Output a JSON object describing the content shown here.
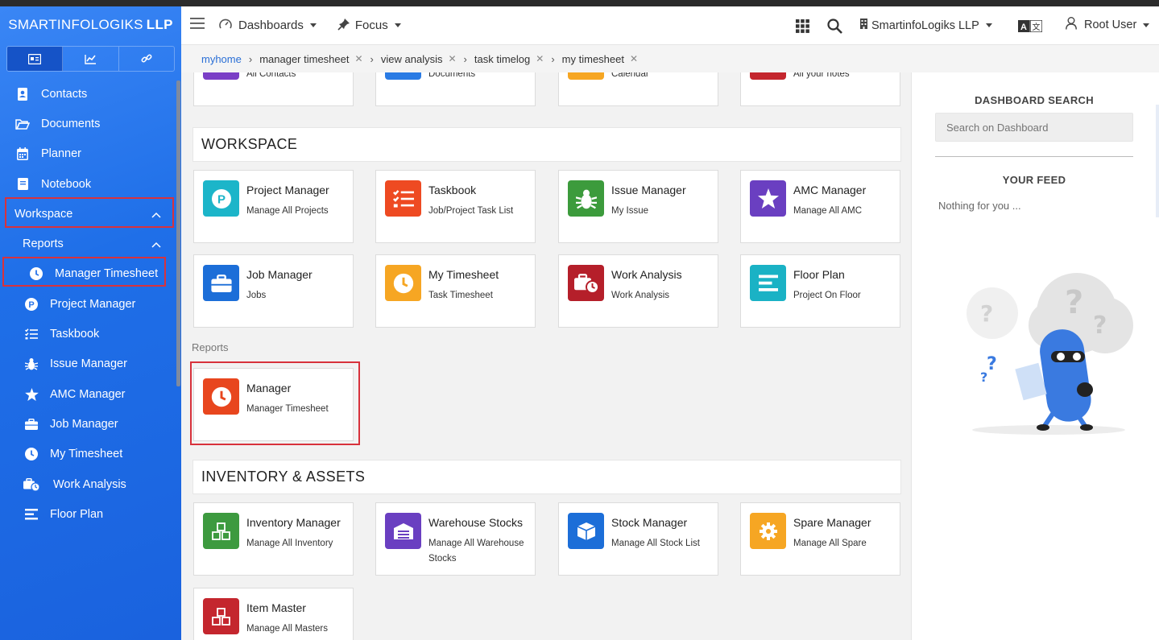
{
  "brand": {
    "name_light": "SMARTINFOLOGIKS",
    "name_bold": "LLP"
  },
  "sidebar": {
    "tabs": [
      {
        "icon": "id-card-icon",
        "active": true
      },
      {
        "icon": "chart-line-icon",
        "active": false
      },
      {
        "icon": "link-icon",
        "active": false
      }
    ],
    "items": [
      {
        "label": "Contacts",
        "icon": "contact-book-icon"
      },
      {
        "label": "Documents",
        "icon": "folder-open-icon"
      },
      {
        "label": "Planner",
        "icon": "calendar-icon"
      },
      {
        "label": "Notebook",
        "icon": "notebook-icon"
      },
      {
        "label": "Workspace",
        "icon": "chevron-up-icon"
      },
      {
        "label": "Reports",
        "icon": "chevron-up-icon"
      },
      {
        "label": "Manager Timesheet",
        "icon": "clock-icon"
      },
      {
        "label": "Project Manager",
        "icon": "p-circle-icon"
      },
      {
        "label": "Taskbook",
        "icon": "task-list-icon"
      },
      {
        "label": "Issue Manager",
        "icon": "bug-icon"
      },
      {
        "label": "AMC Manager",
        "icon": "star-icon"
      },
      {
        "label": "Job Manager",
        "icon": "briefcase-icon"
      },
      {
        "label": "My Timesheet",
        "icon": "clock-icon"
      },
      {
        "label": "Work Analysis",
        "icon": "briefcase-clock-icon"
      },
      {
        "label": "Floor Plan",
        "icon": "align-lines-icon"
      }
    ]
  },
  "topbar": {
    "dashboards": "Dashboards",
    "focus": "Focus",
    "company": "SmartinfoLogiks LLP",
    "user": "Root User"
  },
  "breadcrumb": [
    "myhome",
    "manager timesheet",
    "view analysis",
    "task timelog",
    "my timesheet"
  ],
  "main": {
    "top_cards": [
      {
        "sub": "All Contacts",
        "color": "#7a3fc6"
      },
      {
        "sub": "Documents",
        "color": "#2a7be4"
      },
      {
        "sub": "Calendar",
        "color": "#f6a623"
      },
      {
        "sub": "All your notes",
        "color": "#c4262e"
      }
    ],
    "workspace_title": "WORKSPACE",
    "workspace_cards": [
      {
        "title": "Project Manager",
        "sub": "Manage All Projects",
        "color": "#1cb5c9",
        "icon": "p-circle-icon"
      },
      {
        "title": "Taskbook",
        "sub": "Job/Project Task List",
        "color": "#ee4a22",
        "icon": "task-list-icon"
      },
      {
        "title": "Issue Manager",
        "sub": "My Issue",
        "color": "#3c9b3c",
        "icon": "bug-icon"
      },
      {
        "title": "AMC Manager",
        "sub": "Manage All AMC",
        "color": "#6a3fc1",
        "icon": "star-icon"
      },
      {
        "title": "Job Manager",
        "sub": "Jobs",
        "color": "#1c6ed8",
        "icon": "briefcase-icon"
      },
      {
        "title": "My Timesheet",
        "sub": "Task Timesheet",
        "color": "#f6a623",
        "icon": "clock-icon"
      },
      {
        "title": "Work Analysis",
        "sub": "Work Analysis",
        "color": "#b51f2a",
        "icon": "briefcase-clock-icon"
      },
      {
        "title": "Floor Plan",
        "sub": "Project On Floor",
        "color": "#1ab2c5",
        "icon": "align-lines-icon"
      }
    ],
    "reports_label": "Reports",
    "reports_cards": [
      {
        "title": "Manager",
        "sub": "Manager Timesheet",
        "color": "#e8461e",
        "icon": "clock-icon"
      }
    ],
    "inventory_title": "INVENTORY & ASSETS",
    "inventory_cards": [
      {
        "title": "Inventory Manager",
        "sub": "Manage All Inventory",
        "color": "#3d9a3f",
        "icon": "cubes-icon"
      },
      {
        "title": "Warehouse Stocks",
        "sub": "Manage All Warehouse Stocks",
        "color": "#6a3fc1",
        "icon": "warehouse-icon"
      },
      {
        "title": "Stock Manager",
        "sub": "Manage All Stock List",
        "color": "#1c6ed8",
        "icon": "box-icon"
      },
      {
        "title": "Spare Manager",
        "sub": "Manage All Spare",
        "color": "#f6a623",
        "icon": "gear-icon"
      },
      {
        "title": "Item Master",
        "sub": "Manage All Masters",
        "color": "#c4262e",
        "icon": "cubes-icon"
      }
    ]
  },
  "rightpanel": {
    "search_title": "DASHBOARD SEARCH",
    "search_placeholder": "Search on Dashboard",
    "feed_title": "YOUR FEED",
    "feed_empty": "Nothing for you ..."
  }
}
